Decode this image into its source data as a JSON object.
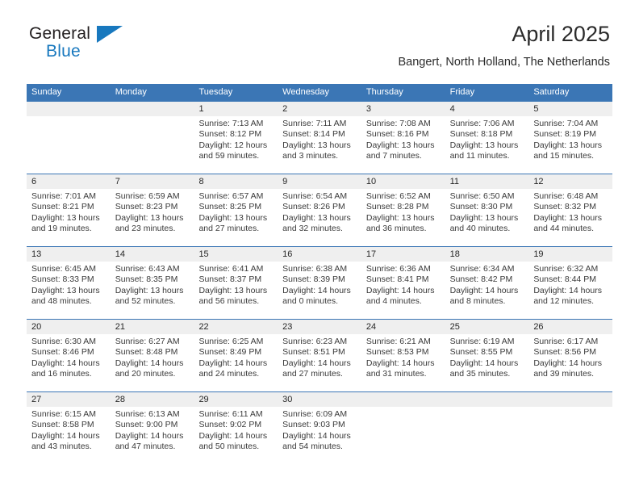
{
  "brand": {
    "name_part1": "General",
    "name_part2": "Blue"
  },
  "header": {
    "title": "April 2025",
    "location": "Bangert, North Holland, The Netherlands"
  },
  "colors": {
    "header_blue": "#3b76b5",
    "date_band_gray": "#efefef",
    "logo_blue": "#1878be",
    "text": "#262626"
  },
  "weekday_headers": [
    "Sunday",
    "Monday",
    "Tuesday",
    "Wednesday",
    "Thursday",
    "Friday",
    "Saturday"
  ],
  "weeks": [
    {
      "days": [
        {
          "num": "",
          "sunrise": "",
          "sunset": "",
          "daylight": ""
        },
        {
          "num": "",
          "sunrise": "",
          "sunset": "",
          "daylight": ""
        },
        {
          "num": "1",
          "sunrise": "Sunrise: 7:13 AM",
          "sunset": "Sunset: 8:12 PM",
          "daylight": "Daylight: 12 hours and 59 minutes."
        },
        {
          "num": "2",
          "sunrise": "Sunrise: 7:11 AM",
          "sunset": "Sunset: 8:14 PM",
          "daylight": "Daylight: 13 hours and 3 minutes."
        },
        {
          "num": "3",
          "sunrise": "Sunrise: 7:08 AM",
          "sunset": "Sunset: 8:16 PM",
          "daylight": "Daylight: 13 hours and 7 minutes."
        },
        {
          "num": "4",
          "sunrise": "Sunrise: 7:06 AM",
          "sunset": "Sunset: 8:18 PM",
          "daylight": "Daylight: 13 hours and 11 minutes."
        },
        {
          "num": "5",
          "sunrise": "Sunrise: 7:04 AM",
          "sunset": "Sunset: 8:19 PM",
          "daylight": "Daylight: 13 hours and 15 minutes."
        }
      ]
    },
    {
      "days": [
        {
          "num": "6",
          "sunrise": "Sunrise: 7:01 AM",
          "sunset": "Sunset: 8:21 PM",
          "daylight": "Daylight: 13 hours and 19 minutes."
        },
        {
          "num": "7",
          "sunrise": "Sunrise: 6:59 AM",
          "sunset": "Sunset: 8:23 PM",
          "daylight": "Daylight: 13 hours and 23 minutes."
        },
        {
          "num": "8",
          "sunrise": "Sunrise: 6:57 AM",
          "sunset": "Sunset: 8:25 PM",
          "daylight": "Daylight: 13 hours and 27 minutes."
        },
        {
          "num": "9",
          "sunrise": "Sunrise: 6:54 AM",
          "sunset": "Sunset: 8:26 PM",
          "daylight": "Daylight: 13 hours and 32 minutes."
        },
        {
          "num": "10",
          "sunrise": "Sunrise: 6:52 AM",
          "sunset": "Sunset: 8:28 PM",
          "daylight": "Daylight: 13 hours and 36 minutes."
        },
        {
          "num": "11",
          "sunrise": "Sunrise: 6:50 AM",
          "sunset": "Sunset: 8:30 PM",
          "daylight": "Daylight: 13 hours and 40 minutes."
        },
        {
          "num": "12",
          "sunrise": "Sunrise: 6:48 AM",
          "sunset": "Sunset: 8:32 PM",
          "daylight": "Daylight: 13 hours and 44 minutes."
        }
      ]
    },
    {
      "days": [
        {
          "num": "13",
          "sunrise": "Sunrise: 6:45 AM",
          "sunset": "Sunset: 8:33 PM",
          "daylight": "Daylight: 13 hours and 48 minutes."
        },
        {
          "num": "14",
          "sunrise": "Sunrise: 6:43 AM",
          "sunset": "Sunset: 8:35 PM",
          "daylight": "Daylight: 13 hours and 52 minutes."
        },
        {
          "num": "15",
          "sunrise": "Sunrise: 6:41 AM",
          "sunset": "Sunset: 8:37 PM",
          "daylight": "Daylight: 13 hours and 56 minutes."
        },
        {
          "num": "16",
          "sunrise": "Sunrise: 6:38 AM",
          "sunset": "Sunset: 8:39 PM",
          "daylight": "Daylight: 14 hours and 0 minutes."
        },
        {
          "num": "17",
          "sunrise": "Sunrise: 6:36 AM",
          "sunset": "Sunset: 8:41 PM",
          "daylight": "Daylight: 14 hours and 4 minutes."
        },
        {
          "num": "18",
          "sunrise": "Sunrise: 6:34 AM",
          "sunset": "Sunset: 8:42 PM",
          "daylight": "Daylight: 14 hours and 8 minutes."
        },
        {
          "num": "19",
          "sunrise": "Sunrise: 6:32 AM",
          "sunset": "Sunset: 8:44 PM",
          "daylight": "Daylight: 14 hours and 12 minutes."
        }
      ]
    },
    {
      "days": [
        {
          "num": "20",
          "sunrise": "Sunrise: 6:30 AM",
          "sunset": "Sunset: 8:46 PM",
          "daylight": "Daylight: 14 hours and 16 minutes."
        },
        {
          "num": "21",
          "sunrise": "Sunrise: 6:27 AM",
          "sunset": "Sunset: 8:48 PM",
          "daylight": "Daylight: 14 hours and 20 minutes."
        },
        {
          "num": "22",
          "sunrise": "Sunrise: 6:25 AM",
          "sunset": "Sunset: 8:49 PM",
          "daylight": "Daylight: 14 hours and 24 minutes."
        },
        {
          "num": "23",
          "sunrise": "Sunrise: 6:23 AM",
          "sunset": "Sunset: 8:51 PM",
          "daylight": "Daylight: 14 hours and 27 minutes."
        },
        {
          "num": "24",
          "sunrise": "Sunrise: 6:21 AM",
          "sunset": "Sunset: 8:53 PM",
          "daylight": "Daylight: 14 hours and 31 minutes."
        },
        {
          "num": "25",
          "sunrise": "Sunrise: 6:19 AM",
          "sunset": "Sunset: 8:55 PM",
          "daylight": "Daylight: 14 hours and 35 minutes."
        },
        {
          "num": "26",
          "sunrise": "Sunrise: 6:17 AM",
          "sunset": "Sunset: 8:56 PM",
          "daylight": "Daylight: 14 hours and 39 minutes."
        }
      ]
    },
    {
      "days": [
        {
          "num": "27",
          "sunrise": "Sunrise: 6:15 AM",
          "sunset": "Sunset: 8:58 PM",
          "daylight": "Daylight: 14 hours and 43 minutes."
        },
        {
          "num": "28",
          "sunrise": "Sunrise: 6:13 AM",
          "sunset": "Sunset: 9:00 PM",
          "daylight": "Daylight: 14 hours and 47 minutes."
        },
        {
          "num": "29",
          "sunrise": "Sunrise: 6:11 AM",
          "sunset": "Sunset: 9:02 PM",
          "daylight": "Daylight: 14 hours and 50 minutes."
        },
        {
          "num": "30",
          "sunrise": "Sunrise: 6:09 AM",
          "sunset": "Sunset: 9:03 PM",
          "daylight": "Daylight: 14 hours and 54 minutes."
        },
        {
          "num": "",
          "sunrise": "",
          "sunset": "",
          "daylight": ""
        },
        {
          "num": "",
          "sunrise": "",
          "sunset": "",
          "daylight": ""
        },
        {
          "num": "",
          "sunrise": "",
          "sunset": "",
          "daylight": ""
        }
      ]
    }
  ]
}
